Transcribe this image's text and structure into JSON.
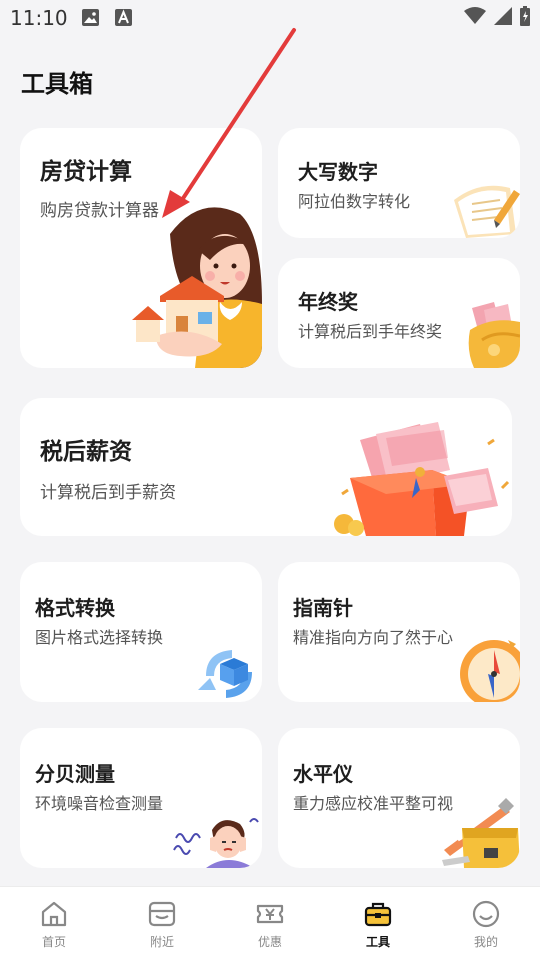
{
  "status_bar": {
    "time": "11:10"
  },
  "header": {
    "title": "工具箱"
  },
  "tools": {
    "mortgage": {
      "title": "房贷计算",
      "subtitle": "购房贷款计算器"
    },
    "uppercase": {
      "title": "大写数字",
      "subtitle": "阿拉伯数字转化"
    },
    "year_end": {
      "title": "年终奖",
      "subtitle": "计算税后到手年终奖"
    },
    "salary": {
      "title": "税后薪资",
      "subtitle": "计算税后到手薪资"
    },
    "format": {
      "title": "格式转换",
      "subtitle": "图片格式选择转换"
    },
    "compass": {
      "title": "指南针",
      "subtitle": "精准指向方向了然于心"
    },
    "decibel": {
      "title": "分贝测量",
      "subtitle": "环境噪音检查测量"
    },
    "level": {
      "title": "水平仪",
      "subtitle": "重力感应校准平整可视"
    }
  },
  "tab_bar": {
    "items": [
      {
        "label": "首页",
        "icon": "home-icon"
      },
      {
        "label": "附近",
        "icon": "shop-icon"
      },
      {
        "label": "优惠",
        "icon": "coupon-icon"
      },
      {
        "label": "工具",
        "icon": "toolbox-icon",
        "active": true
      },
      {
        "label": "我的",
        "icon": "profile-icon"
      }
    ]
  },
  "colors": {
    "accent": "#111111",
    "inactive": "#888888",
    "annotation_arrow": "#e33b3b"
  }
}
